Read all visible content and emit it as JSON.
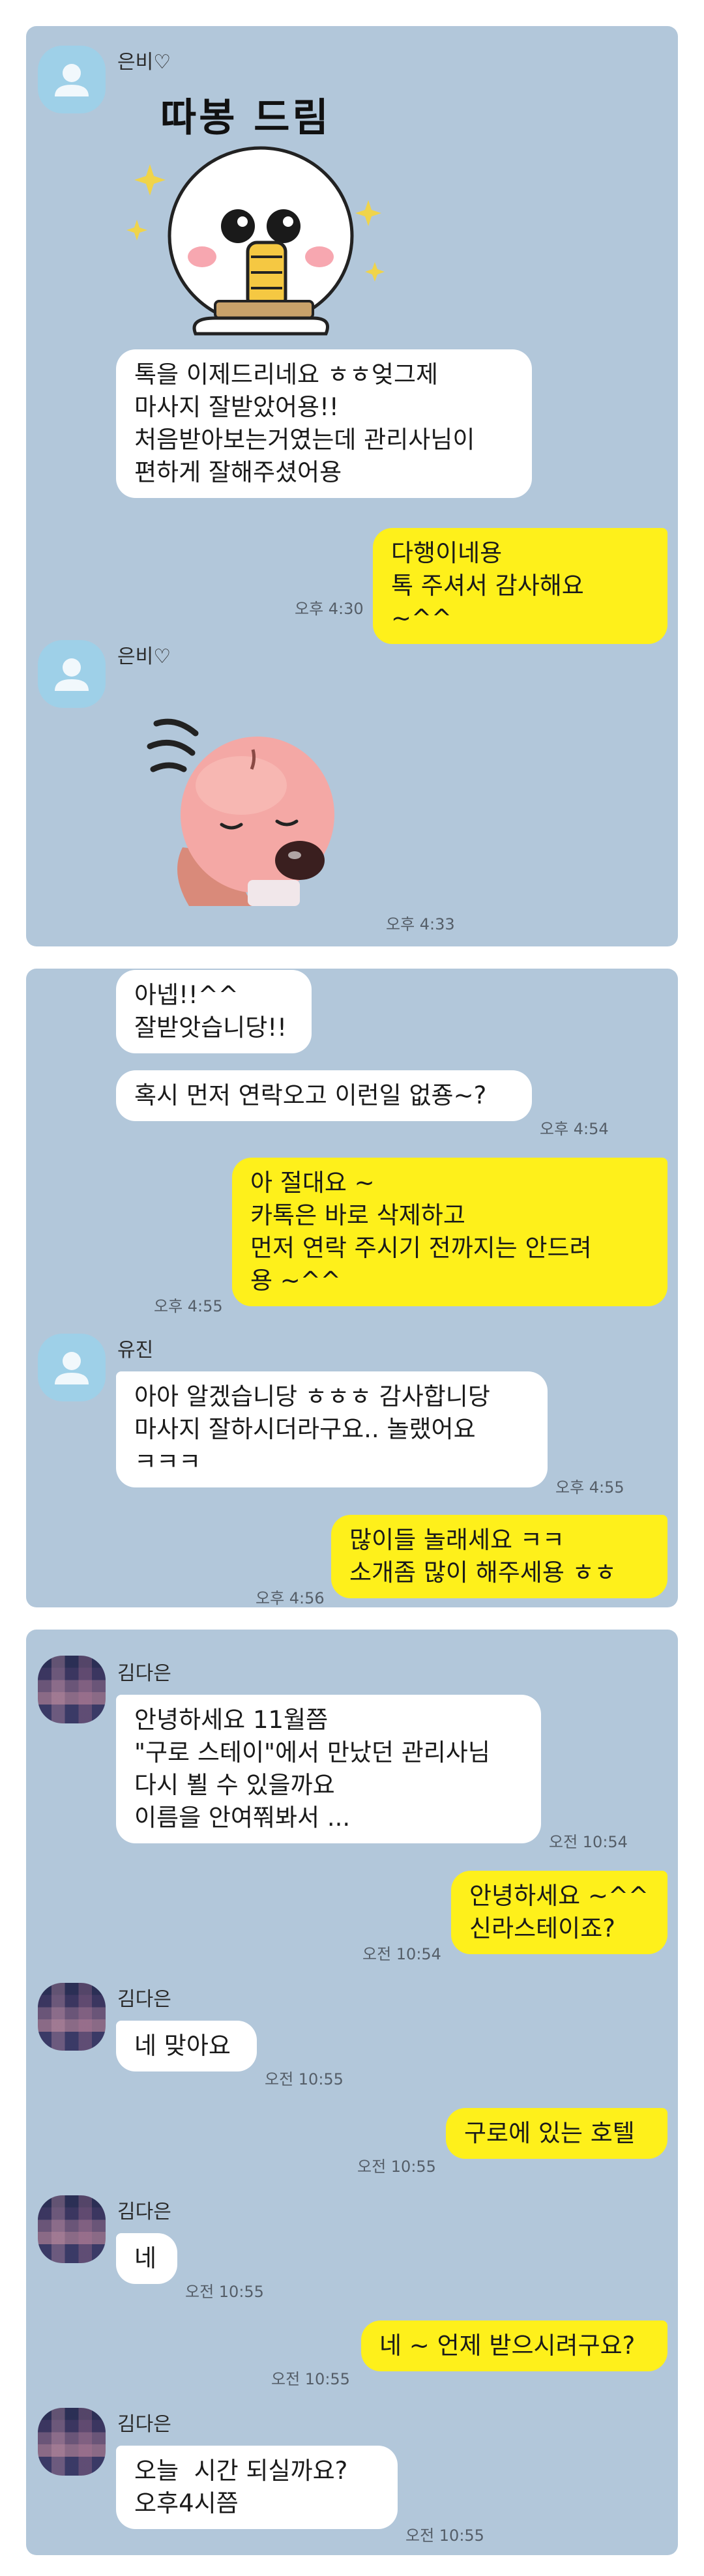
{
  "panel1": {
    "sender1": "은비♡",
    "sticker_text": "따봉 드림",
    "msg1": "톡을 이제드리네요 ㅎㅎ엊그제\n마사지 잘받았어용!!\n처음받아보는거였는데 관리사님이\n편하게 잘해주셨어용",
    "reply1": "다행이네용\n톡 주셔서 감사해요 ~^^",
    "reply1_time": "오후 4:30",
    "sender2": "은비♡",
    "sticker2_time": "오후 4:33"
  },
  "panel2": {
    "msg1": "아넵!!^^\n잘받앗습니당!!",
    "msg2": "혹시 먼저 연락오고 이런일 없죵~?",
    "msg2_time": "오후 4:54",
    "reply1": "아 절대요 ~\n카톡은 바로 삭제하고\n먼저 연락 주시기 전까지는 안드려\n용 ~^^",
    "reply1_time": "오후 4:55",
    "sender": "유진",
    "msg3": "아아 알겠습니당 ㅎㅎㅎ 감사합니당\n마사지 잘하시더라구요.. 놀랬어요\nㅋㅋㅋ",
    "msg3_time": "오후 4:55",
    "reply2": "많이들 놀래세요 ㅋㅋ\n소개좀 많이 해주세용 ㅎㅎ",
    "reply2_time": "오후 4:56"
  },
  "panel3": {
    "sender": "김다은",
    "msg1": "안녕하세요 11월쯤\n\"구로 스테이\"에서 만났던 관리사님\n다시 뵐 수 있을까요\n이름을 안여쭤봐서 ...",
    "msg1_time": "오전 10:54",
    "reply1": "안녕하세요 ~^^\n신라스테이죠?",
    "reply1_time": "오전 10:54",
    "msg2": "네 맞아요",
    "msg2_time": "오전 10:55",
    "reply2": "구로에 있는 호텔",
    "reply2_time": "오전 10:55",
    "msg3": "네",
    "msg3_time": "오전 10:55",
    "reply3": "네 ~ 언제 받으시려구요?",
    "reply3_time": "오전 10:55",
    "msg4": "오늘  시간 되실까요?\n오후4시쯤",
    "msg4_time": "오전 10:55"
  },
  "colors": {
    "chat_background": "#b2c7da",
    "my_bubble": "#fef01b",
    "their_bubble": "#ffffff",
    "default_avatar": "#9ed0e8"
  },
  "icons": [
    "default-profile-icon",
    "thumbs-up-sticker",
    "pink-beaver-sticker"
  ]
}
